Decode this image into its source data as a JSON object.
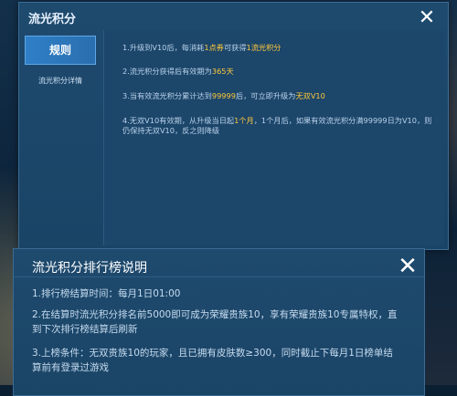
{
  "top_dialog": {
    "title": "流光积分",
    "tabs": [
      {
        "label": "规则"
      },
      {
        "label": "流光积分详情"
      }
    ],
    "rules": [
      {
        "parts": [
          {
            "t": "1.升级到V10后，每消耗"
          },
          {
            "t": "1点券",
            "hl": true
          },
          {
            "t": "可获得"
          },
          {
            "t": "1流光积分",
            "hl": true
          }
        ]
      },
      {
        "parts": [
          {
            "t": "2.流光积分获得后有效期为"
          },
          {
            "t": "365天",
            "hl": true
          }
        ]
      },
      {
        "parts": [
          {
            "t": "3.当有效流光积分累计达到"
          },
          {
            "t": "99999",
            "hl": true
          },
          {
            "t": "后，可立即升级为"
          },
          {
            "t": "无双V10",
            "hl": true
          }
        ]
      },
      {
        "parts": [
          {
            "t": "4.无双V10有效期，从升级当日起"
          },
          {
            "t": "1个月",
            "hl": true
          },
          {
            "t": "，1个月后，如果有效流光积分满99999日为V10，则仍保持无双V10，反之则降级"
          }
        ]
      }
    ]
  },
  "bottom_dialog": {
    "title": "流光积分排行榜说明",
    "rules": [
      "1.排行榜结算时间：每月1日01:00",
      "2.在结算时流光积分排名前5000即可成为荣耀贵族10，享有荣耀贵族10专属特权，直到下次排行榜结算后刷新",
      "3.上榜条件：无双贵族10的玩家，且已拥有皮肤数≥300，同时截止下每月1日榜单结算前有登录过游戏"
    ]
  },
  "icons": {
    "close": "close-icon"
  },
  "colors": {
    "highlight": "#ffc93c",
    "panel": "#1c466a",
    "active_tab": "#2f7fc8"
  }
}
